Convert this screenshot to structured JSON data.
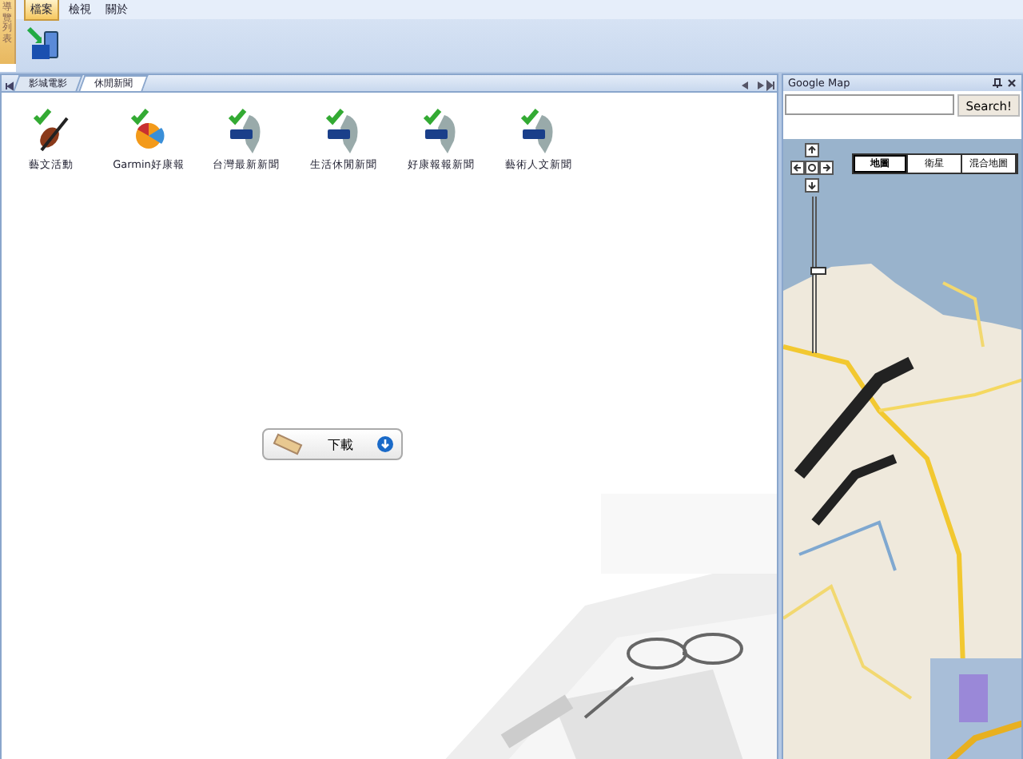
{
  "side_strip": {
    "label": "導覽列表"
  },
  "menu": [
    {
      "label": "檔案",
      "selected": true
    },
    {
      "label": "檢視",
      "selected": false
    },
    {
      "label": "關於",
      "selected": false
    }
  ],
  "tabs": [
    {
      "label": "影城電影",
      "selected": false
    },
    {
      "label": "休閒新聞",
      "selected": true
    }
  ],
  "items": [
    {
      "label": "藝文活動",
      "kind": "violin"
    },
    {
      "label": "Garmin好康報",
      "kind": "pie"
    },
    {
      "label": "台灣最新新聞",
      "kind": "taiwan"
    },
    {
      "label": "生活休閒新聞",
      "kind": "taiwan"
    },
    {
      "label": "好康報報新聞",
      "kind": "taiwan"
    },
    {
      "label": "藝術人文新聞",
      "kind": "taiwan"
    }
  ],
  "download_button": {
    "label": "下載"
  },
  "map_panel": {
    "title": "Google Map",
    "search_button": "Search!",
    "map_types": [
      {
        "label": "地圖",
        "selected": true
      },
      {
        "label": "衛星",
        "selected": false
      },
      {
        "label": "混合地圖",
        "selected": false
      }
    ],
    "zoom": {
      "level": 0.55
    }
  }
}
